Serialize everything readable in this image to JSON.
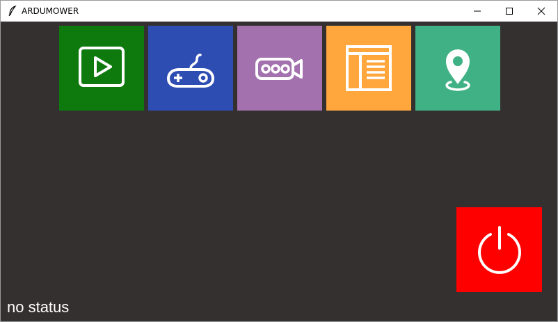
{
  "window": {
    "title": "ARDUMOWER",
    "controls": {
      "minimize": "minimize-icon",
      "maximize": "maximize-icon",
      "close": "close-icon"
    }
  },
  "tiles": [
    {
      "name": "play",
      "icon": "play-icon",
      "color": "#0e7a0e"
    },
    {
      "name": "gamepad",
      "icon": "gamepad-icon",
      "color": "#2d4db3"
    },
    {
      "name": "camera",
      "icon": "video-camera-icon",
      "color": "#a371ad"
    },
    {
      "name": "layout",
      "icon": "layout-icon",
      "color": "#ffa63d"
    },
    {
      "name": "map",
      "icon": "map-pin-icon",
      "color": "#3fb184"
    }
  ],
  "power": {
    "icon": "power-icon",
    "color": "#ff0000"
  },
  "status": {
    "text": "no status"
  },
  "colors": {
    "background": "#353030",
    "titlebar": "#ffffff"
  }
}
